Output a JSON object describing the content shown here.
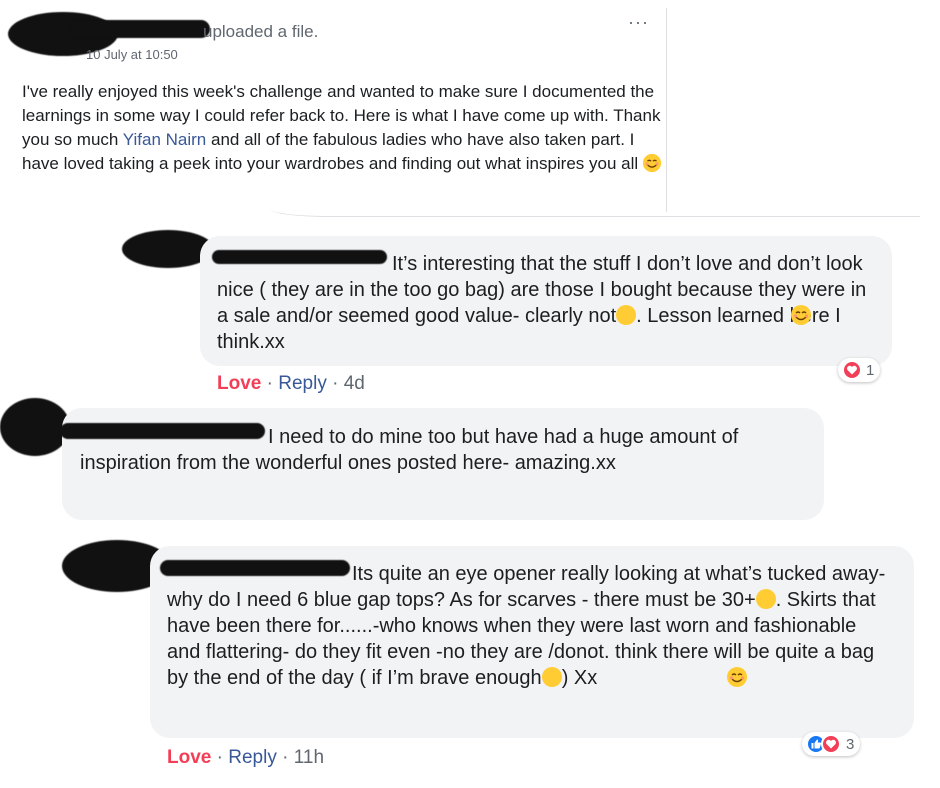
{
  "post": {
    "header_text": "uploaded a file.",
    "timestamp": "10 July at 10:50",
    "more_label": "···",
    "body_before_link": "I've really enjoyed this week's challenge and wanted to make sure I documented the learnings in some way I could refer back to. Here is what I have come up with. Thank you so much ",
    "link_name": "Yifan Nairn",
    "body_after_link": " and all of the fabulous ladies who have also taken part. I have loved taking a peek into your wardrobes and finding out what inspires you all"
  },
  "comments": [
    {
      "text_part1": "It’s interesting that the stuff I don’t love and don’t look nice ( they are in the too go bag) are those I bought because they were in a sale and/or seemed good value- clearly not",
      "text_part2": ". Lesson learned here I think.xx",
      "love_label": "Love",
      "reply_label": "Reply",
      "sep": "·",
      "age": "4d",
      "reaction_count": "1"
    },
    {
      "text": "I need to do mine too but have had a huge amount of inspiration from the wonderful ones posted here- amazing.xx"
    },
    {
      "text_part1": "Its quite an eye opener really looking at what’s tucked away- why do I need 6 blue gap tops? As for scarves - there must be 30+",
      "text_part2": ". Skirts that have been there for......-who knows when they were last worn and fashionable and flattering- do they fit even -no they are /donot. think there will be quite a bag by the end of the day ( if I’m brave enough",
      "text_part3": ") Xx",
      "love_label": "Love",
      "reply_label": "Reply",
      "sep": "·",
      "age": "11h",
      "reaction_count": "3"
    }
  ],
  "colors": {
    "love": "#f33e58",
    "link": "#385898",
    "bubble": "#f2f3f5",
    "like": "#1877f2"
  },
  "icons": [
    "more-options-icon",
    "smiling-emoji-icon",
    "worried-emoji-icon",
    "heart-reaction-icon",
    "like-reaction-icon"
  ]
}
